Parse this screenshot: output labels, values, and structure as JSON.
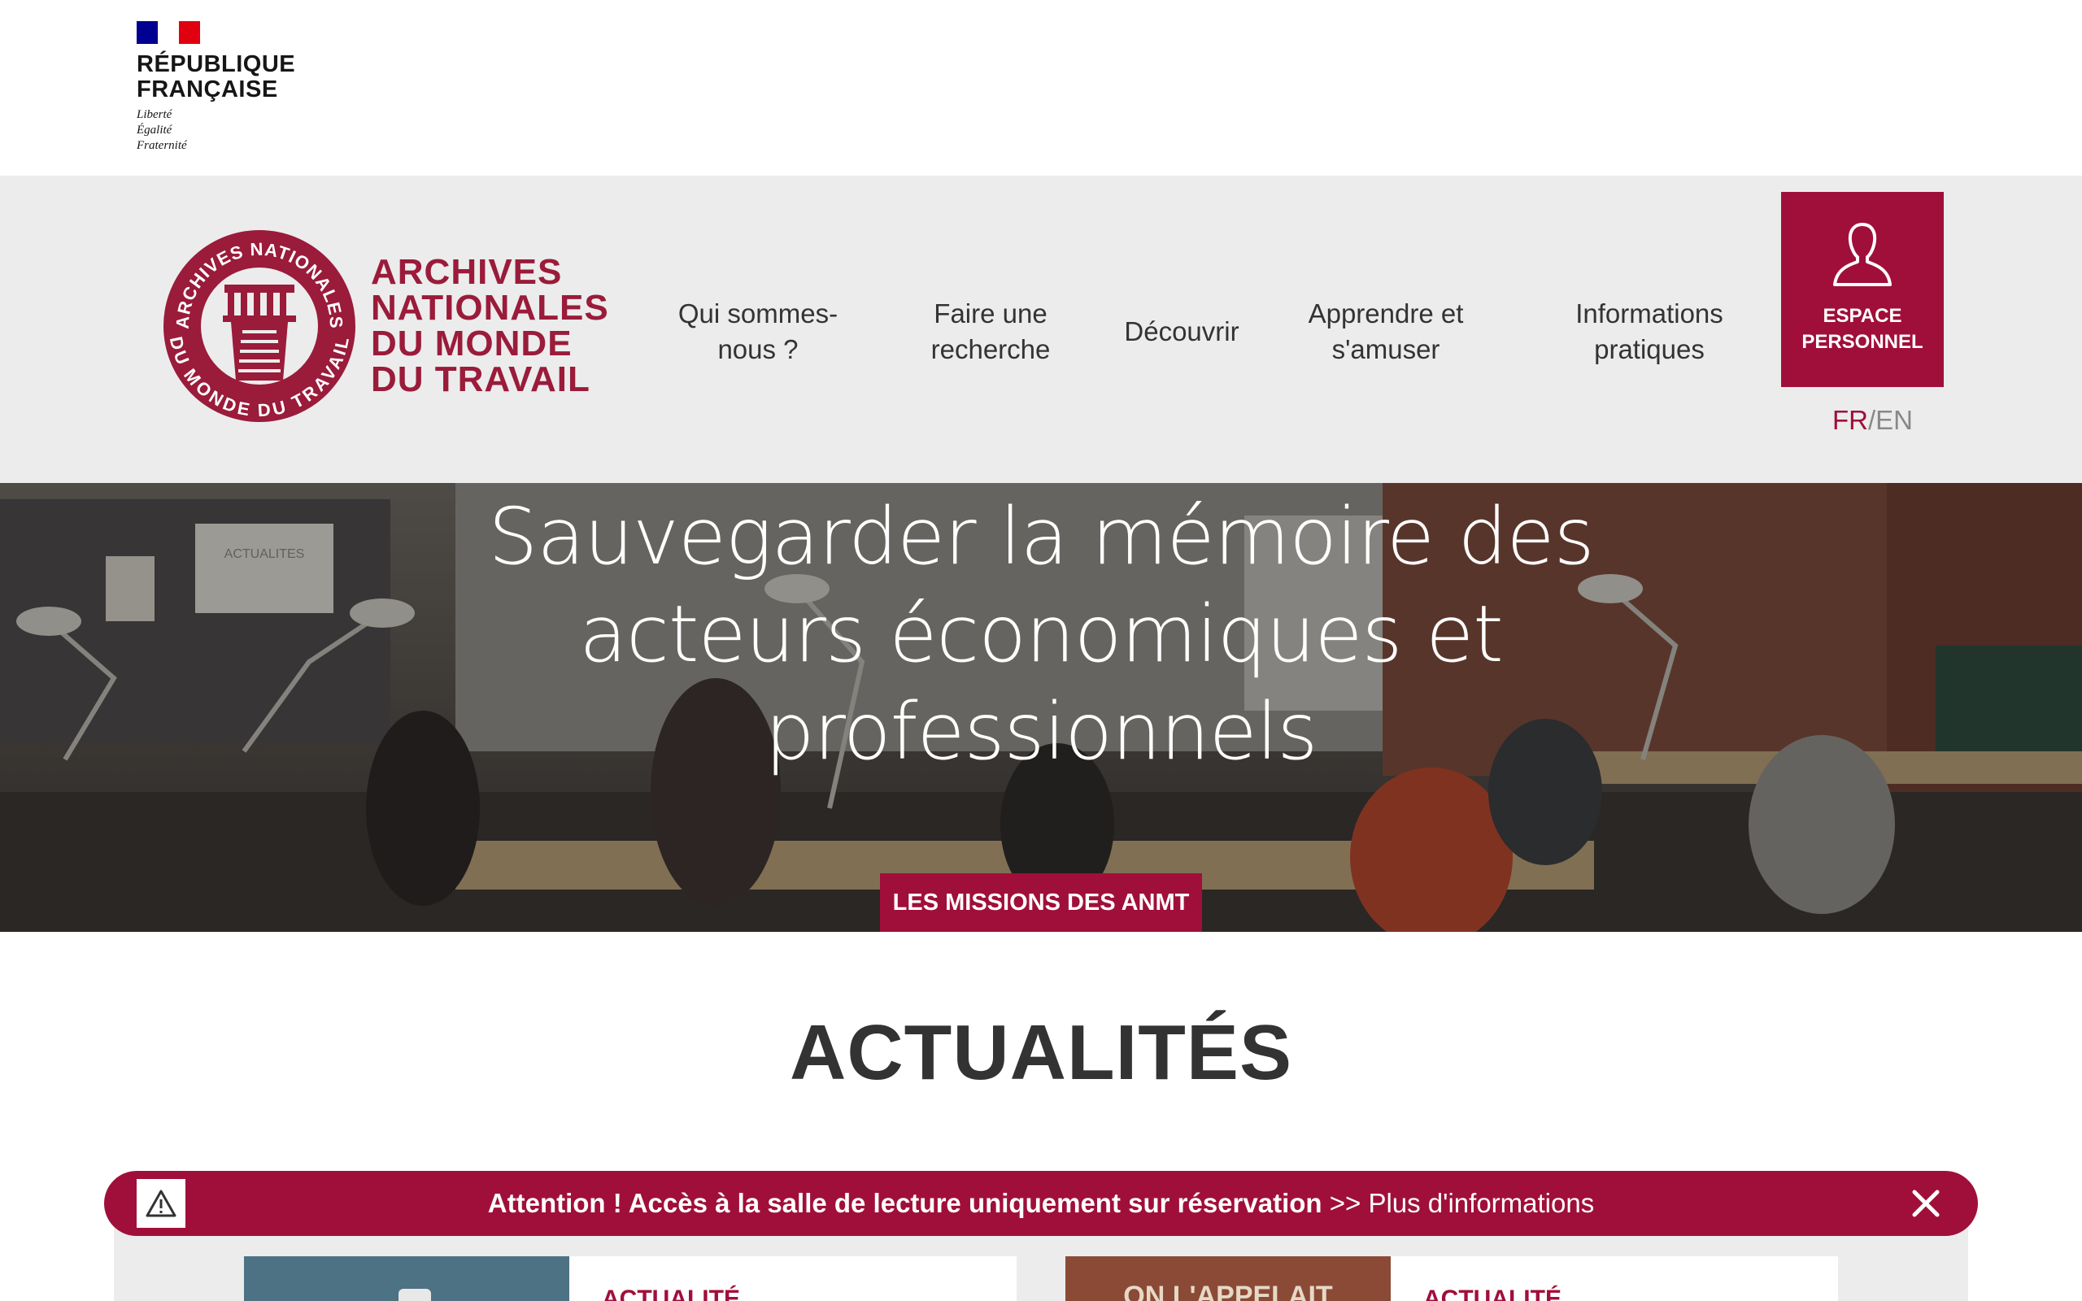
{
  "gov": {
    "name_line1": "RÉPUBLIQUE",
    "name_line2": "FRANÇAISE",
    "motto": [
      "Liberté",
      "Égalité",
      "Fraternité"
    ]
  },
  "logo": {
    "lines": [
      "ARCHIVES",
      "NATIONALES",
      "DU MONDE",
      "DU TRAVAIL"
    ],
    "seal_top": "ARCHIVES NATIONALES",
    "seal_bottom": "DU MONDE DU TRAVAIL"
  },
  "nav": {
    "items": [
      {
        "line1": "Qui sommes-",
        "line2": "nous ?"
      },
      {
        "line1": "Faire une",
        "line2": "recherche"
      },
      {
        "line1": "Découvrir",
        "line2": ""
      },
      {
        "line1": "Apprendre et",
        "line2": "s'amuser"
      },
      {
        "line1": "Informations",
        "line2": "pratiques"
      }
    ],
    "espace_line1": "ESPACE",
    "espace_line2": "PERSONNEL",
    "lang_fr": "FR",
    "lang_sep": "/",
    "lang_en": "EN"
  },
  "hero": {
    "title_lines": [
      "Sauvegarder la mémoire des",
      "acteurs économiques et",
      "professionnels"
    ],
    "button": "LES MISSIONS DES ANMT",
    "poster_label": "ACTUALITES"
  },
  "news": {
    "title": "ACTUALITÉS",
    "cards": [
      {
        "tag": "ACTUALITÉ"
      },
      {
        "tag": "ACTUALITÉ",
        "thumb_text": "ON L'APPELAIT"
      }
    ]
  },
  "alert": {
    "bold_text": "Attention ! Accès à la salle de lecture uniquement sur réservation",
    "link_text": " >> Plus d'informations"
  },
  "colors": {
    "brand": "#a00f3a",
    "header_bg": "#ececec",
    "gov_blue": "#000091",
    "gov_red": "#e1000f"
  }
}
